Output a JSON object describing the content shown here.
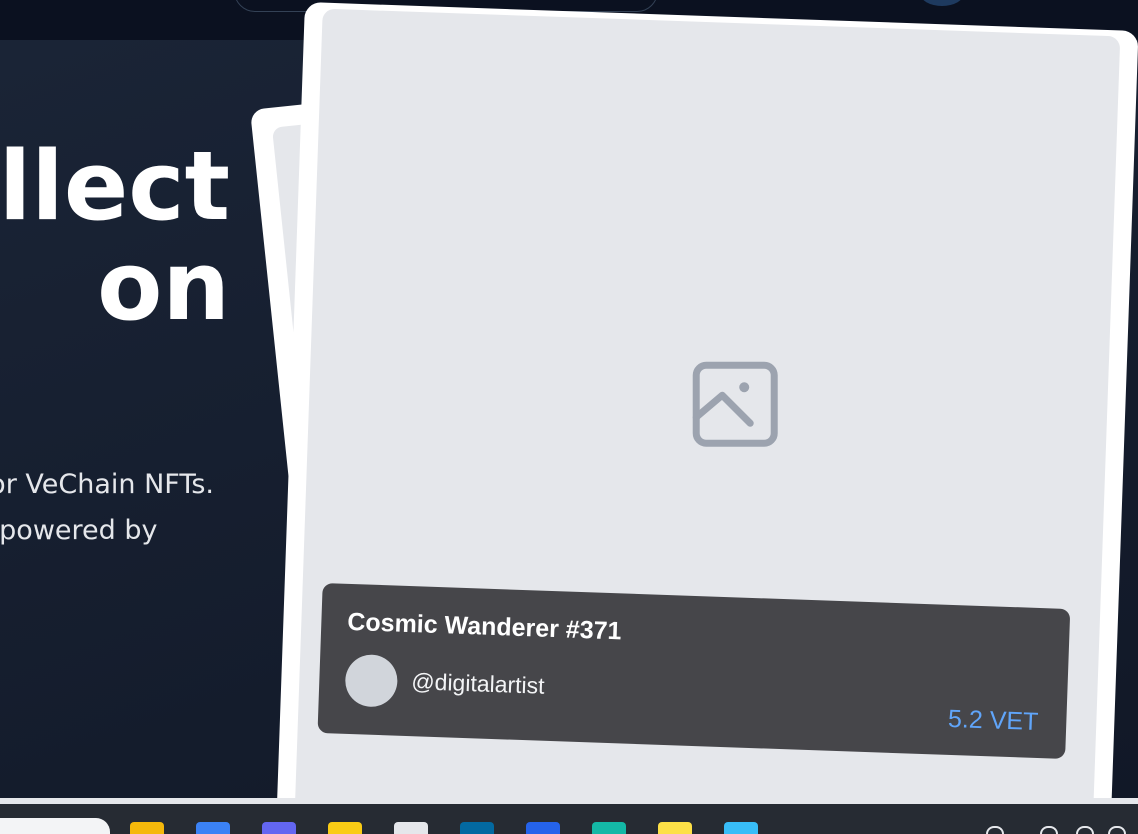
{
  "hero": {
    "title_line1": "ollect",
    "title_line2": "on",
    "subtitle_line1": "or VeChain NFTs.",
    "subtitle_line2": "powered by"
  },
  "nft_card": {
    "title": "Cosmic Wanderer #371",
    "creator_handle": "@digitalartist",
    "price": "5.2 VET",
    "image_icon": "image-placeholder-icon"
  },
  "colors": {
    "page_bg": "#111827",
    "panel_bg": "#46464a",
    "price_accent": "#60a5fa",
    "card_bg": "#ffffff",
    "image_bg": "#e5e7eb"
  },
  "taskbar": {
    "icons": [
      {
        "name": "file-explorer-icon",
        "color": "#f5b80b"
      },
      {
        "name": "copilot-icon",
        "color": "#3b82f6"
      },
      {
        "name": "teams-icon",
        "color": "#6366f1"
      },
      {
        "name": "folder-icon",
        "color": "#facc15"
      },
      {
        "name": "store-icon",
        "color": "#e5e7eb"
      },
      {
        "name": "mail-icon",
        "color": "#0369a1"
      },
      {
        "name": "dropbox-icon",
        "color": "#2563eb"
      },
      {
        "name": "edge-icon",
        "color": "#14b8a6"
      },
      {
        "name": "sticky-notes-icon",
        "color": "#fde047"
      },
      {
        "name": "notepad-icon",
        "color": "#38bdf8"
      }
    ]
  }
}
